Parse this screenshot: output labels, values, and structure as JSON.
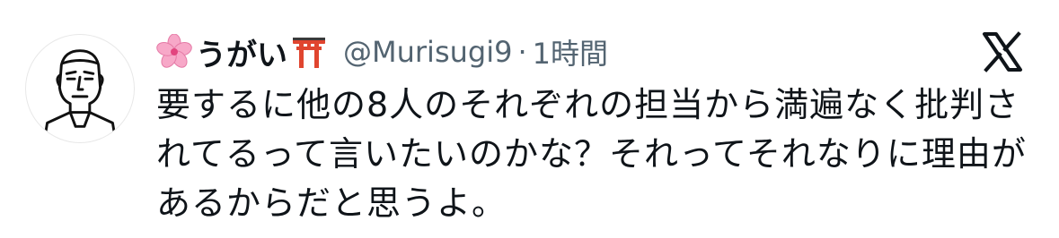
{
  "tweet": {
    "avatar_icon": "line-drawing-face-avatar",
    "display_name": "うがい",
    "name_emoji_before": "cherry-blossom-icon",
    "name_emoji_after": "torii-gate-icon",
    "handle": "@Murisugi9",
    "separator": "·",
    "timestamp": "1時間",
    "text": "要するに他の8人のそれぞれの担当から満遍なく批判されてるって言いたいのかな？それってそれなりに理由があるからだと思うよ。",
    "brand_icon": "x-logo-icon"
  },
  "colors": {
    "text_primary": "#0f1419",
    "text_secondary": "#536471",
    "background": "#ffffff"
  }
}
